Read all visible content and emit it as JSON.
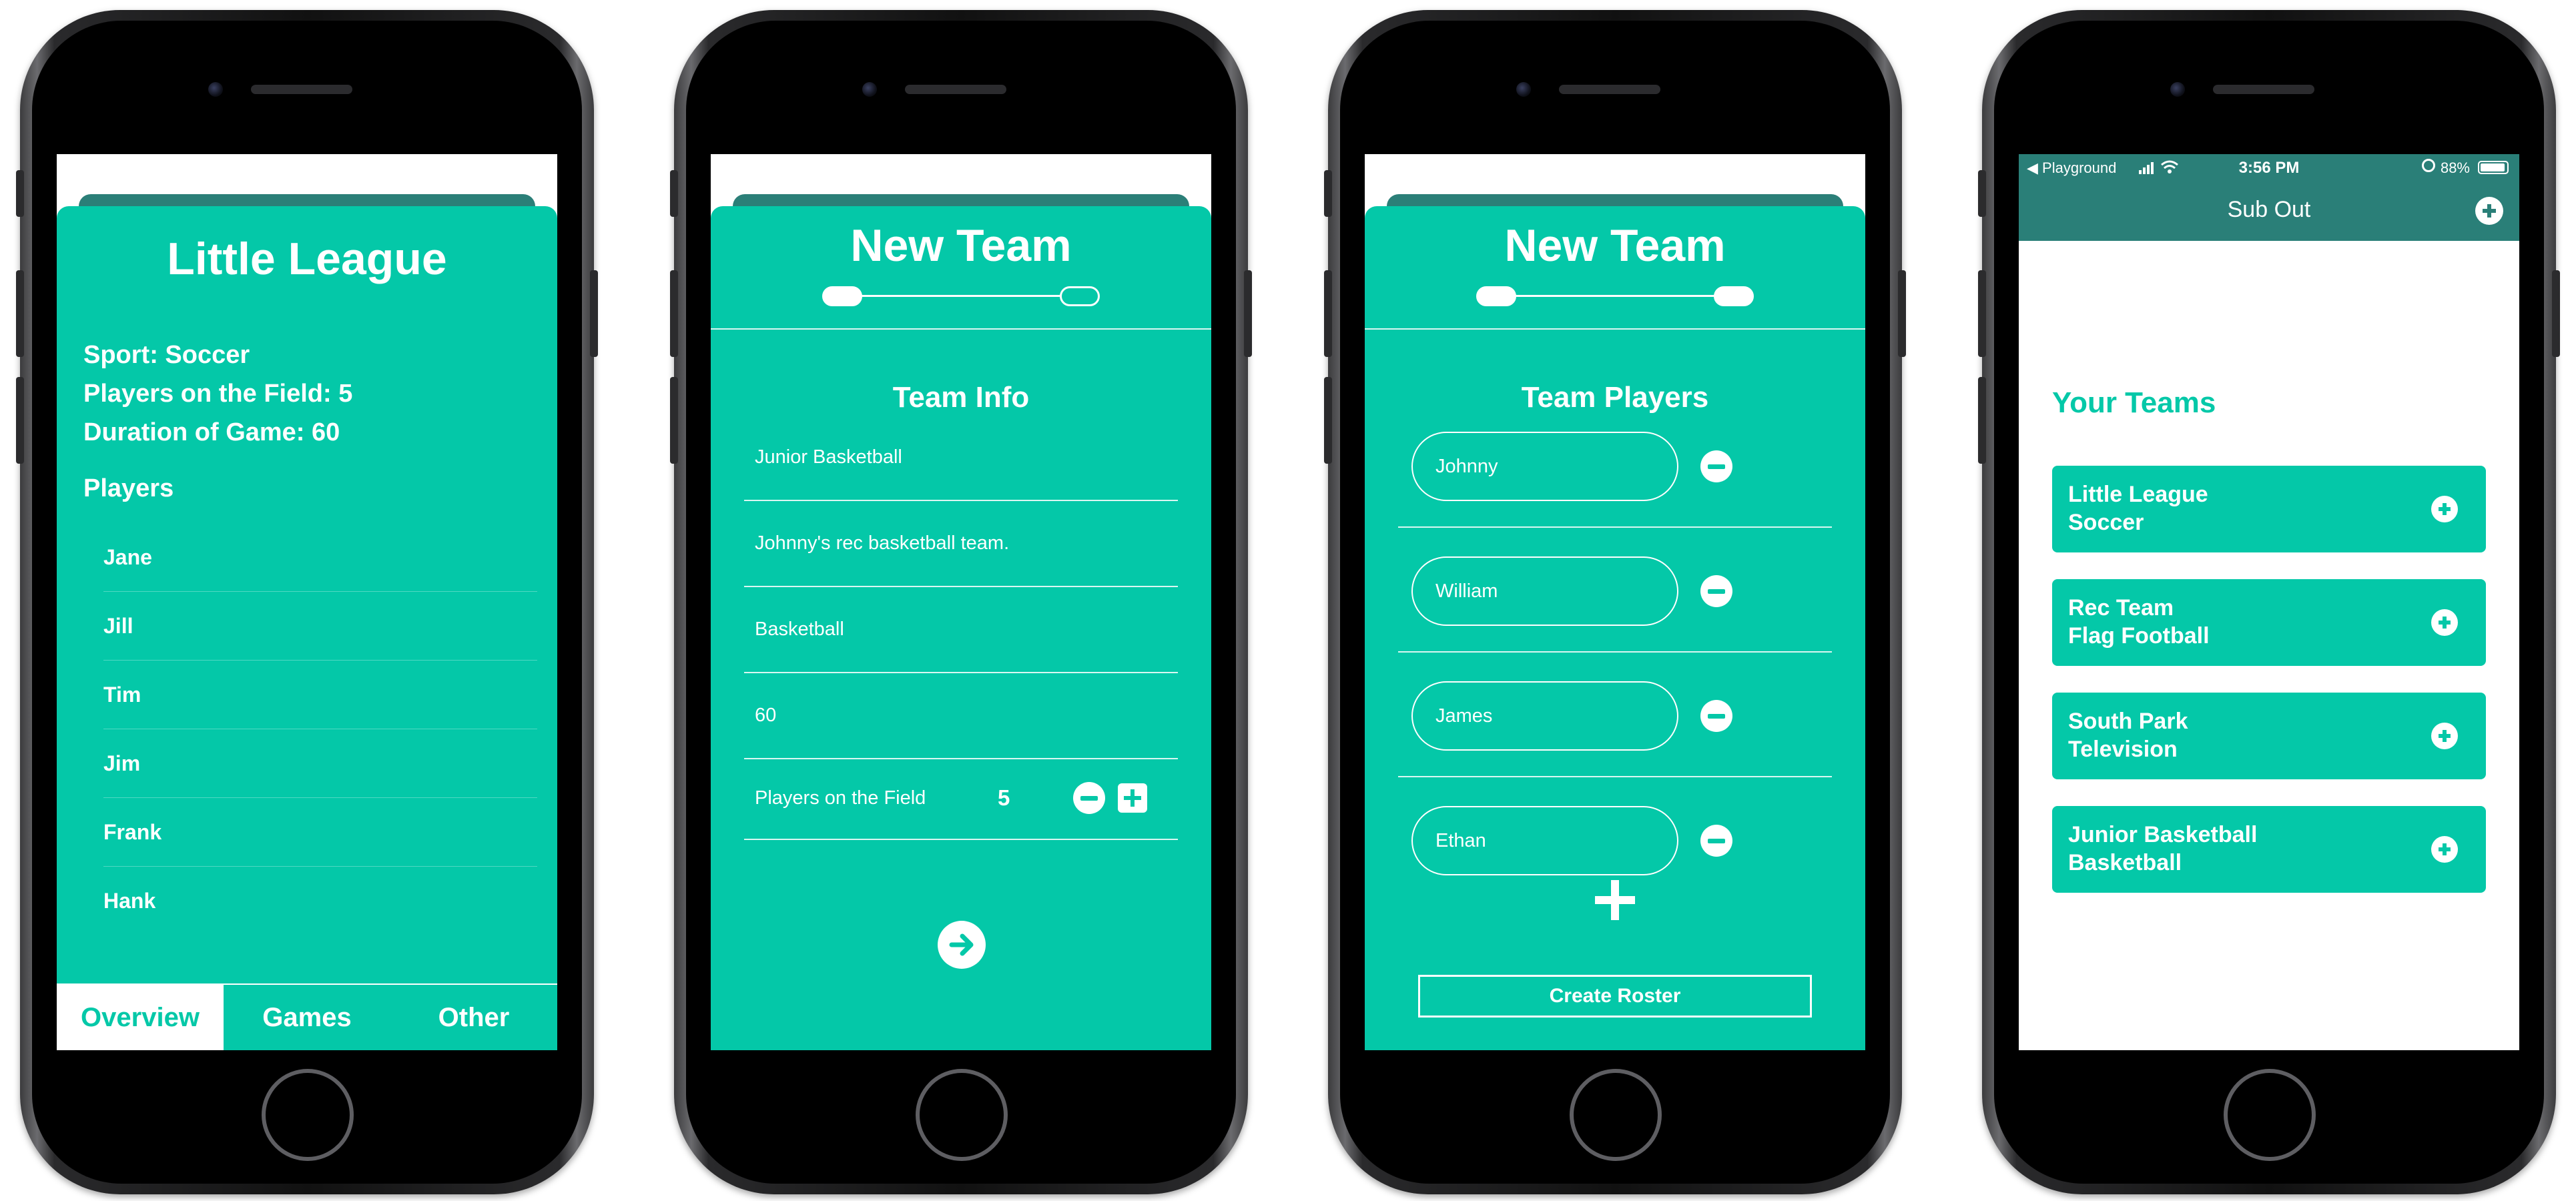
{
  "colors": {
    "accent": "#04c8a8",
    "accent_dark": "#2a7f78",
    "phone": "#111111",
    "screen_bg": "#ffffff"
  },
  "screen1": {
    "title": "Little League",
    "sport": "Sport: Soccer",
    "players_on_field": "Players on the Field: 5",
    "duration": "Duration of Game: 60",
    "players_heading": "Players",
    "players": [
      "Jane",
      "Jill",
      "Tim",
      "Jim",
      "Frank",
      "Hank"
    ],
    "tabs": [
      {
        "label": "Overview",
        "active": true
      },
      {
        "label": "Games",
        "active": false
      },
      {
        "label": "Other",
        "active": false
      }
    ]
  },
  "screen2": {
    "title": "New Team",
    "step": 1,
    "total_steps": 2,
    "section": "Team Info",
    "fields": [
      "Junior Basketball",
      "Johnny's rec basketball team.",
      "Basketball",
      "60"
    ],
    "players_label": "Players on the Field",
    "players_value": "5",
    "next_icon": "arrow-right-circle-icon"
  },
  "screen3": {
    "title": "New Team",
    "step": 2,
    "total_steps": 2,
    "section": "Team Players",
    "players": [
      "Johnny",
      "William",
      "James",
      "Ethan"
    ],
    "add_icon": "plus-icon",
    "create_label": "Create Roster"
  },
  "screen4": {
    "status": {
      "carrier": "◀ Playground",
      "time": "3:56 PM",
      "battery": "88%"
    },
    "nav_title": "Sub Out",
    "section": "Your Teams",
    "teams": [
      {
        "name": "Little League",
        "sport": "Soccer"
      },
      {
        "name": "Rec Team",
        "sport": "Flag Football"
      },
      {
        "name": "South Park",
        "sport": "Television"
      },
      {
        "name": "Junior Basketball",
        "sport": "Basketball"
      }
    ]
  }
}
